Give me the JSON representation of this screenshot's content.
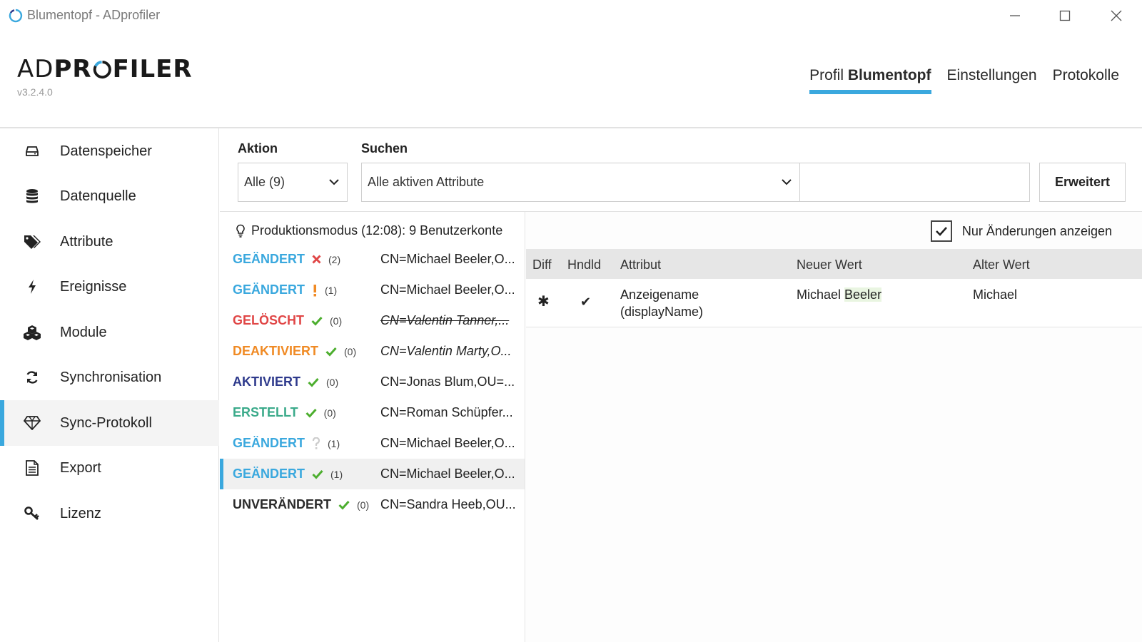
{
  "window": {
    "title": "Blumentopf  - ADprofiler"
  },
  "logo": {
    "brand_a": "AD",
    "brand_b": "PR",
    "brand_c": "FILER",
    "version": "v3.2.4.0"
  },
  "topnav": {
    "profile_prefix": "Profil ",
    "profile_name": "Blumentopf",
    "settings": "Einstellungen",
    "logs": "Protokolle"
  },
  "sidebar": {
    "items": [
      {
        "label": "Datenspeicher",
        "icon": "drive-icon"
      },
      {
        "label": "Datenquelle",
        "icon": "database-icon"
      },
      {
        "label": "Attribute",
        "icon": "tags-icon"
      },
      {
        "label": "Ereignisse",
        "icon": "lightning-icon"
      },
      {
        "label": "Module",
        "icon": "cubes-icon"
      },
      {
        "label": "Synchronisation",
        "icon": "sync-icon"
      },
      {
        "label": "Sync-Protokoll",
        "icon": "diamond-icon"
      },
      {
        "label": "Export",
        "icon": "document-icon"
      },
      {
        "label": "Lizenz",
        "icon": "key-icon"
      }
    ],
    "active_index": 6
  },
  "filters": {
    "action_label": "Aktion",
    "action_value": "Alle (9)",
    "search_label": "Suchen",
    "search_scope": "Alle aktiven Attribute",
    "search_text": "",
    "advanced_button": "Erweitert"
  },
  "list": {
    "header": "Produktionsmodus (12:08): 9 Benutzerkonte",
    "items": [
      {
        "status": "GEÄNDERT",
        "color": "#3aa8de",
        "mark": "cross",
        "mark_color": "#e04646",
        "count": "(2)",
        "dn": "CN=Michael Beeler,O...",
        "style": "normal"
      },
      {
        "status": "GEÄNDERT",
        "color": "#3aa8de",
        "mark": "exclamation",
        "mark_color": "#f08a24",
        "count": "(1)",
        "dn": "CN=Michael Beeler,O...",
        "style": "normal"
      },
      {
        "status": "GELÖSCHT",
        "color": "#e04646",
        "mark": "check",
        "mark_color": "#4cae2e",
        "count": "(0)",
        "dn": "CN=Valentin Tanner,...",
        "style": "strike"
      },
      {
        "status": "DEAKTIVIERT",
        "color": "#f08a24",
        "mark": "check",
        "mark_color": "#4cae2e",
        "count": "(0)",
        "dn": "CN=Valentin Marty,O...",
        "style": "italic"
      },
      {
        "status": "AKTIVIERT",
        "color": "#2e3a8c",
        "mark": "check",
        "mark_color": "#4cae2e",
        "count": "(0)",
        "dn": "CN=Jonas Blum,OU=...",
        "style": "normal"
      },
      {
        "status": "ERSTELLT",
        "color": "#3aaa8a",
        "mark": "check",
        "mark_color": "#4cae2e",
        "count": "(0)",
        "dn": "CN=Roman Schüpfer...",
        "style": "normal"
      },
      {
        "status": "GEÄNDERT",
        "color": "#3aa8de",
        "mark": "question",
        "mark_color": "#cccccc",
        "count": "(1)",
        "dn": "CN=Michael Beeler,O...",
        "style": "normal"
      },
      {
        "status": "GEÄNDERT",
        "color": "#3aa8de",
        "mark": "check",
        "mark_color": "#4cae2e",
        "count": "(1)",
        "dn": "CN=Michael Beeler,O...",
        "style": "normal"
      },
      {
        "status": "UNVERÄNDERT",
        "color": "#2a2a2a",
        "mark": "check",
        "mark_color": "#4cae2e",
        "count": "(0)",
        "dn": "CN=Sandra Heeb,OU...",
        "style": "normal"
      }
    ],
    "selected_index": 7
  },
  "detail": {
    "only_changes_label": "Nur Änderungen anzeigen",
    "only_changes_checked": true,
    "columns": [
      "Diff",
      "Hndld",
      "Attribut",
      "Neuer Wert",
      "Alter Wert"
    ],
    "rows": [
      {
        "diff": "✱",
        "handled": "✔",
        "attribute_line1": "Anzeigename",
        "attribute_line2": "(displayName)",
        "new_value_a": "Michael ",
        "new_value_b": "Beeler",
        "old_value": "Michael"
      }
    ]
  },
  "colors": {
    "accent": "#3aa8de",
    "divider": "#e2e2e2"
  }
}
